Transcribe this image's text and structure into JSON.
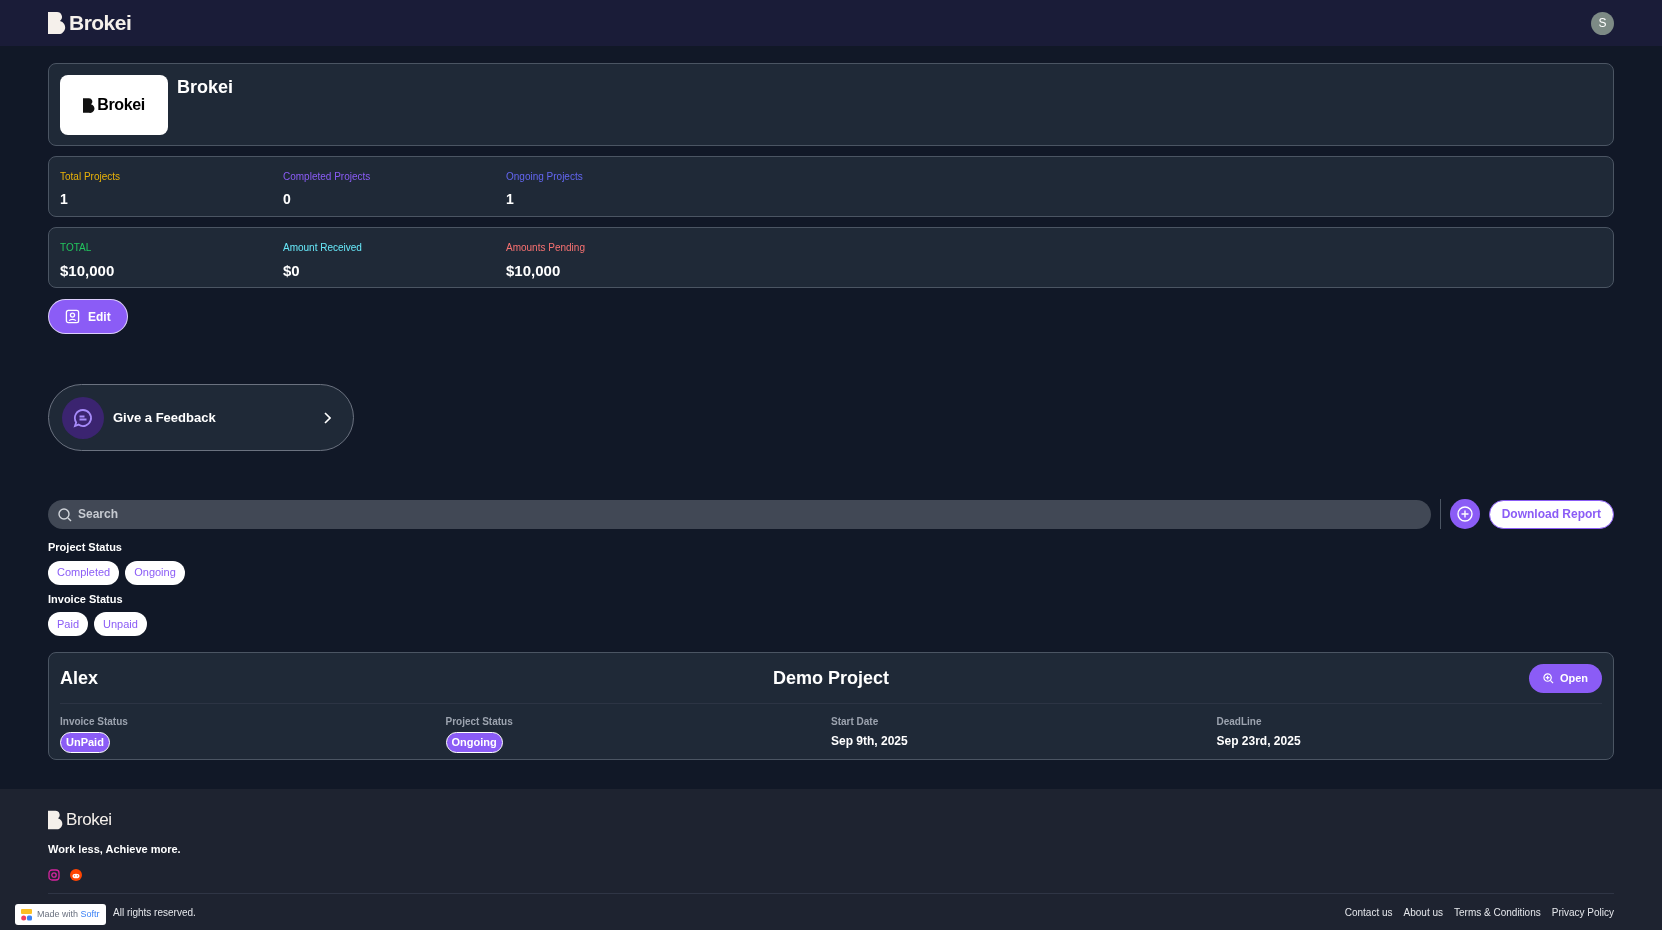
{
  "header": {
    "logo_text": "Brokei",
    "avatar": "S"
  },
  "profile": {
    "logo_text": "Brokei",
    "name": "Brokei"
  },
  "project_stats": [
    {
      "label": "Total Projects",
      "value": "1",
      "color": "#eab308"
    },
    {
      "label": "Completed Projects",
      "value": "0",
      "color": "#8b5cf6"
    },
    {
      "label": "Ongoing Projects",
      "value": "1",
      "color": "#6366f1"
    }
  ],
  "amount_stats": [
    {
      "label": "TOTAL",
      "value": "$10,000",
      "color": "#22c55e"
    },
    {
      "label": "Amount Received",
      "value": "$0",
      "color": "#67e8f9"
    },
    {
      "label": "Amounts Pending",
      "value": "$10,000",
      "color": "#f87171"
    }
  ],
  "edit_button": "Edit",
  "feedback": {
    "label": "Give a Feedback"
  },
  "search": {
    "placeholder": "Search"
  },
  "download_button": "Download Report",
  "filters": [
    {
      "title": "Project Status",
      "options": [
        {
          "label": "Completed",
          "selected": false
        },
        {
          "label": "Ongoing",
          "selected": false
        }
      ]
    },
    {
      "title": "Invoice Status",
      "options": [
        {
          "label": "Paid",
          "selected": false
        },
        {
          "label": "Unpaid",
          "selected": false
        }
      ]
    }
  ],
  "projects": [
    {
      "client": "Alex",
      "title": "Demo Project",
      "open_button": "Open",
      "fields": [
        {
          "label": "Invoice Status",
          "value": "UnPaid",
          "kind": "badge"
        },
        {
          "label": "Project Status",
          "value": "Ongoing",
          "kind": "badge"
        },
        {
          "label": "Start Date",
          "value": "Sep 9th, 2025",
          "kind": "text"
        },
        {
          "label": "DeadLine",
          "value": "Sep 23rd, 2025",
          "kind": "text"
        }
      ]
    }
  ],
  "footer": {
    "logo_text": "Brokei",
    "tagline": "Work less, Achieve more.",
    "copyright": "All rights reserved.",
    "links": [
      "Contact us",
      "About us",
      "Terms & Conditions",
      "Privacy Policy"
    ],
    "badge": {
      "prefix": "Made with",
      "brand": "Softr"
    }
  }
}
